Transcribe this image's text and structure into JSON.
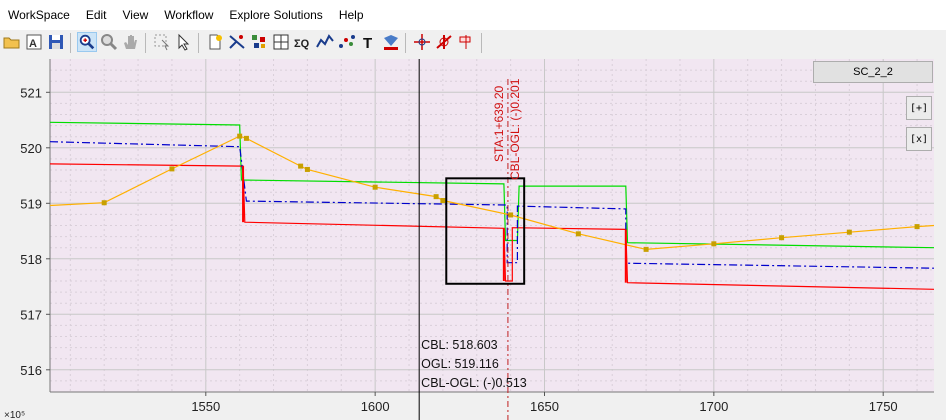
{
  "menu": [
    "WorkSpace",
    "Edit",
    "View",
    "Workflow",
    "Explore Solutions",
    "Help"
  ],
  "toolbar": {
    "icons": [
      "open-folder-icon",
      "print-preview-icon",
      "save-icon",
      "zoom-in-icon",
      "zoom-out-icon",
      "pan-hand-icon",
      "select-cursor-icon",
      "pointer-icon",
      "new-page-icon",
      "line-style-icon",
      "data-points-icon",
      "grid-icon",
      "sigma-q-icon",
      "line-chart-icon",
      "scatter-icon",
      "text-icon",
      "color-fill-icon",
      "crosshair-icon",
      "clear-marker-icon",
      "pin-marker-icon"
    ]
  },
  "series_button": "SC_2_2",
  "side_buttons": {
    "expand": "[+]",
    "close": "[x]"
  },
  "readout": {
    "cbl": "CBL: 518.603",
    "ogl": "OGL: 519.116",
    "diff": "CBL-OGL: (-)0.513"
  },
  "station_label": "STA:1+639.20",
  "station_diff_label": "CBL-OGL: (-)0.201",
  "x_exponent_label": "×10⁵",
  "colors": {
    "plot_bg": "#f1e6f1",
    "green": "#00dd00",
    "red": "#ff0000",
    "blue": "#0000cc",
    "orange": "#ffb000",
    "marker": "#c8a000"
  },
  "chart_data": {
    "type": "line",
    "xlim": [
      1504,
      1765
    ],
    "ylim": [
      515.6,
      521.6
    ],
    "x_ticks": [
      1550,
      1600,
      1650,
      1700,
      1750
    ],
    "y_ticks": [
      516,
      517,
      518,
      519,
      520,
      521
    ],
    "grid": true,
    "cursor_x": 1613,
    "station_x": 1639.2,
    "selection_box": {
      "x": [
        1621,
        1644
      ],
      "y": [
        517.55,
        519.45
      ]
    },
    "series": [
      {
        "color": "green",
        "style": "solid",
        "points": [
          [
            1504,
            520.46
          ],
          [
            1560,
            520.41
          ],
          [
            1560.5,
            519.42
          ],
          [
            1638,
            519.35
          ],
          [
            1638.5,
            518.33
          ],
          [
            1642,
            518.33
          ],
          [
            1642.5,
            519.31
          ],
          [
            1674,
            519.31
          ],
          [
            1674.5,
            518.29
          ],
          [
            1765,
            518.2
          ]
        ]
      },
      {
        "color": "red",
        "style": "solid",
        "points": [
          [
            1504,
            519.71
          ],
          [
            1561,
            519.67
          ],
          [
            1561.5,
            518.66
          ],
          [
            1638,
            518.55
          ],
          [
            1638.5,
            517.6
          ],
          [
            1640.5,
            517.6
          ],
          [
            1640.5,
            518.56
          ],
          [
            1674,
            518.53
          ],
          [
            1674.5,
            517.57
          ],
          [
            1765,
            517.45
          ]
        ]
      },
      {
        "color": "blue",
        "style": "dashdot",
        "points": [
          [
            1504,
            520.11
          ],
          [
            1560,
            520.02
          ],
          [
            1562,
            519.04
          ],
          [
            1639,
            518.97
          ],
          [
            1639,
            517.93
          ],
          [
            1642,
            517.93
          ],
          [
            1642,
            518.95
          ],
          [
            1674,
            518.9
          ],
          [
            1674,
            517.92
          ],
          [
            1765,
            517.83
          ]
        ]
      },
      {
        "color": "orange",
        "style": "solid",
        "markers": true,
        "points": [
          [
            1504,
            518.96
          ],
          [
            1520,
            519.01
          ],
          [
            1540,
            519.62
          ],
          [
            1560,
            520.21
          ],
          [
            1562,
            520.17
          ],
          [
            1578,
            519.67
          ],
          [
            1580,
            519.61
          ],
          [
            1600,
            519.29
          ],
          [
            1618,
            519.12
          ],
          [
            1620,
            519.05
          ],
          [
            1640,
            518.79
          ],
          [
            1660,
            518.45
          ],
          [
            1680,
            518.17
          ],
          [
            1700,
            518.27
          ],
          [
            1720,
            518.38
          ],
          [
            1740,
            518.48
          ],
          [
            1760,
            518.58
          ],
          [
            1765,
            518.6
          ]
        ]
      }
    ]
  }
}
